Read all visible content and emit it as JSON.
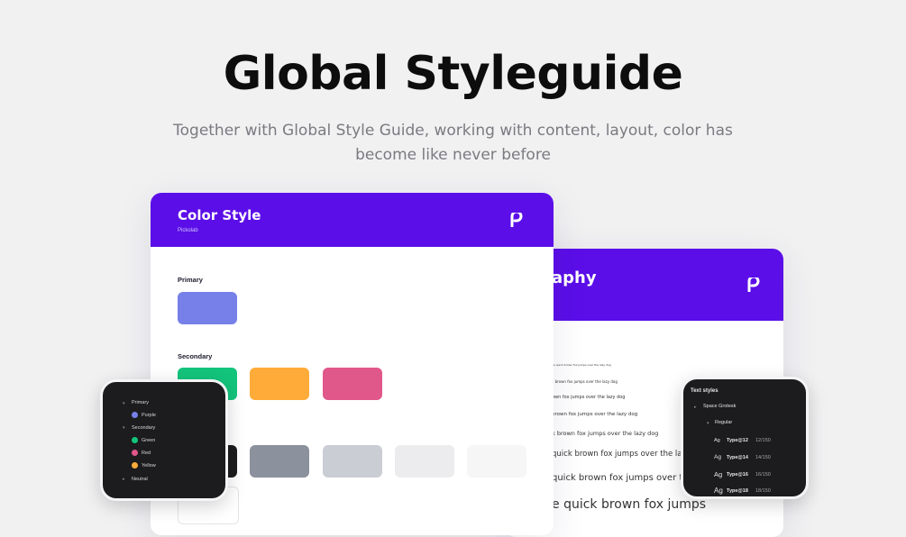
{
  "hero": {
    "title": "Global Styleguide",
    "subtitle_line1": "Together with Global Style Guide, working with content, layout, color has",
    "subtitle_line2": "become like never before"
  },
  "color_card": {
    "title": "Color Style",
    "subtitle": "Pickolab",
    "logo_icon": "pickolab-logo-icon",
    "sections": {
      "primary": {
        "label": "Primary",
        "swatches": [
          "#7680e8"
        ]
      },
      "secondary": {
        "label": "Secondary",
        "swatches": [
          "#13c47c",
          "#ffab3a",
          "#e0578a"
        ]
      },
      "neutral": {
        "swatches": [
          "#1c1c1e",
          "#8c919e",
          "#cacdd4",
          "#ececee",
          "#f6f6f7"
        ]
      }
    }
  },
  "typography_card": {
    "title_visible": "aphy",
    "logo_icon": "pickolab-logo-icon",
    "samples": [
      "he quick brown fox jumps over the lazy dog",
      "k brown fox jumps over the lazy dog",
      "own fox jumps over the lazy dog",
      "brown fox jumps over the lazy dog",
      "k brown fox jumps over the lazy dog",
      "quick brown fox jumps over the lazy dog",
      "quick brown fox jumps over the lazy dog",
      "e quick brown fox jumps"
    ]
  },
  "layers_panel": {
    "items": [
      {
        "label": "Primary",
        "type": "group"
      },
      {
        "label": "Purple",
        "color": "#7680e8"
      },
      {
        "label": "Secondary",
        "type": "group"
      },
      {
        "label": "Green",
        "color": "#13c47c"
      },
      {
        "label": "Red",
        "color": "#e0578a"
      },
      {
        "label": "Yellow",
        "color": "#ffab3a"
      },
      {
        "label": "Neutral",
        "type": "group"
      }
    ]
  },
  "text_styles_panel": {
    "header": "Text styles",
    "font_group": "Space Grotesk",
    "weight_group": "Regular",
    "styles": [
      {
        "preview": "Ag",
        "name": "Type@12",
        "meta": "12/150"
      },
      {
        "preview": "Ag",
        "name": "Type@14",
        "meta": "14/150"
      },
      {
        "preview": "Ag",
        "name": "Type@16",
        "meta": "16/150"
      },
      {
        "preview": "Ag",
        "name": "Type@18",
        "meta": "18/150"
      }
    ]
  },
  "colors": {
    "brand": "#5b0ee8",
    "background": "#f1f1f2",
    "panel": "#1c1c1e"
  }
}
